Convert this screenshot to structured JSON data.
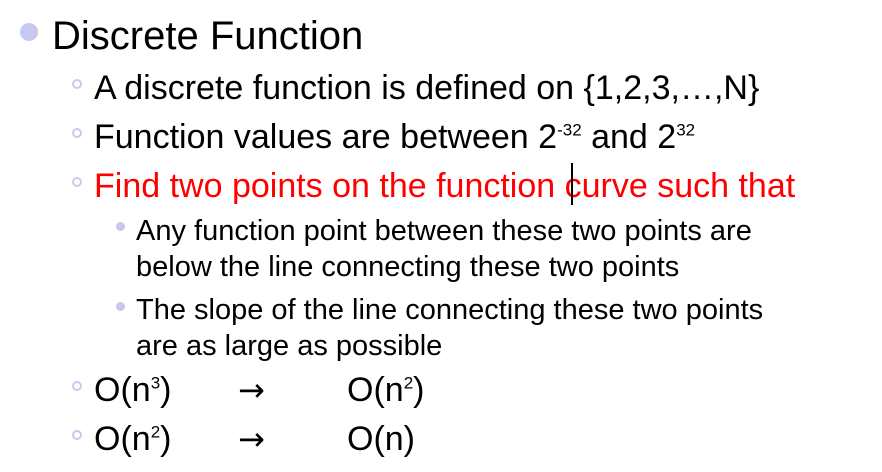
{
  "colors": {
    "bullet": "#c7c8ef",
    "text": "#000000",
    "highlight": "#ff0000"
  },
  "title": "Discrete Function",
  "items": {
    "i1": "A discrete function is defined on {1,2,3,…,N}",
    "i2": {
      "before": "Function values are between 2",
      "exp1": "-32",
      "middle": " and 2",
      "exp2": "32"
    },
    "i3": "Find two points on the function curve such that",
    "sub1": [
      "Any function point between these two points are",
      "below the line connecting these two points"
    ],
    "sub2": [
      "The slope of the line connecting these two points",
      "are as large as possible"
    ],
    "row1": {
      "from_base": "O(n",
      "from_exp": "3",
      "from_close": ")",
      "arrow": "→",
      "to_base": "O(n",
      "to_exp": "2",
      "to_close": ")"
    },
    "row2": {
      "from_base": "O(n",
      "from_exp": "2",
      "from_close": ")",
      "arrow": "→",
      "to": "O(n)"
    }
  }
}
